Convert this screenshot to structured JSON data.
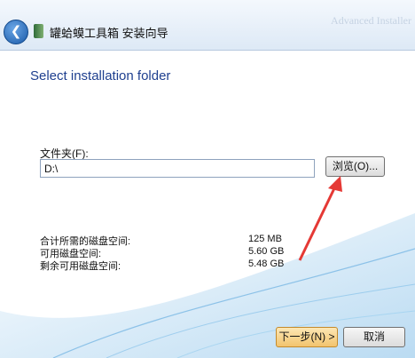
{
  "title": "罐蛤蟆工具箱 安装向导",
  "brand": "Advanced Installer",
  "heading": "Select installation folder",
  "folder_label": "文件夹(F):",
  "folder_value": "D:\\",
  "browse_label": "浏览(O)...",
  "space": [
    {
      "label": "合计所需的磁盘空间:",
      "value": "125 MB"
    },
    {
      "label": "可用磁盘空间:",
      "value": "5.60 GB"
    },
    {
      "label": "剩余可用磁盘空间:",
      "value": "5.48 GB"
    }
  ],
  "next_label": "下一步(N) >",
  "cancel_label": "取消",
  "icons": {
    "back": "back-arrow-icon",
    "app": "app-icon"
  },
  "colors": {
    "heading": "#1e3f8f",
    "accent_arrow": "#e53935"
  }
}
